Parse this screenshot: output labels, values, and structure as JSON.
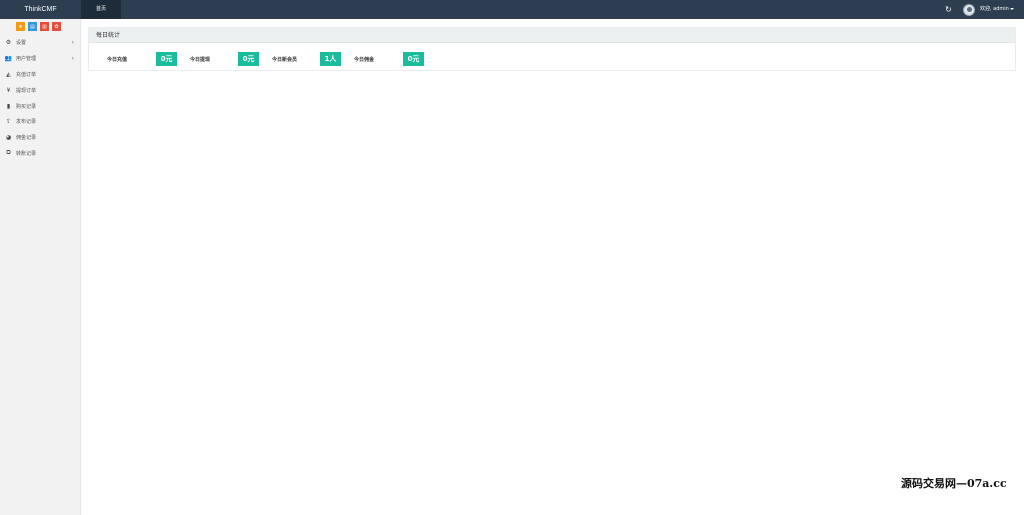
{
  "navbar": {
    "brand": "ThinkCMF",
    "tab_label": "首页",
    "refresh_icon": "refresh-icon",
    "welcome_text": "欢迎, admin",
    "colors": {
      "bar": "#2c3e50",
      "active_tab": "#1e2b38"
    }
  },
  "sidebar": {
    "shortcuts": [
      {
        "icon": "star-icon",
        "glyph": "★",
        "color": "#f39c12"
      },
      {
        "icon": "file-icon",
        "glyph": "▤",
        "color": "#3498db"
      },
      {
        "icon": "trash-icon",
        "glyph": "▥",
        "color": "#e74c3c"
      },
      {
        "icon": "gear-icon",
        "glyph": "✿",
        "color": "#e74c3c"
      }
    ],
    "items": [
      {
        "label": "设置",
        "icon": "cogs-icon",
        "glyph": "⚙",
        "has_children": true
      },
      {
        "label": "用户管理",
        "icon": "users-icon",
        "glyph": "👥",
        "has_children": true
      },
      {
        "label": "充值订单",
        "icon": "area-chart-icon",
        "glyph": "◭",
        "has_children": false
      },
      {
        "label": "提现订单",
        "icon": "yen-icon",
        "glyph": "¥",
        "has_children": false
      },
      {
        "label": "购买记录",
        "icon": "bar-chart-icon",
        "glyph": "▮",
        "has_children": false
      },
      {
        "label": "发布记录",
        "icon": "upload-icon",
        "glyph": "⇪",
        "has_children": false
      },
      {
        "label": "佣金记录",
        "icon": "pie-chart-icon",
        "glyph": "◕",
        "has_children": false
      },
      {
        "label": "转账记录",
        "icon": "transfer-icon",
        "glyph": "⧉",
        "has_children": false
      }
    ]
  },
  "main": {
    "panel_title": "每日统计",
    "stats": [
      {
        "label": "今日充值",
        "value": "0元"
      },
      {
        "label": "今日提现",
        "value": "0元"
      },
      {
        "label": "今日新会员",
        "value": "1人"
      },
      {
        "label": "今日佣金",
        "value": "0元"
      }
    ],
    "badge_color": "#1abc9c"
  },
  "watermark": "源码交易网—07a.cc"
}
